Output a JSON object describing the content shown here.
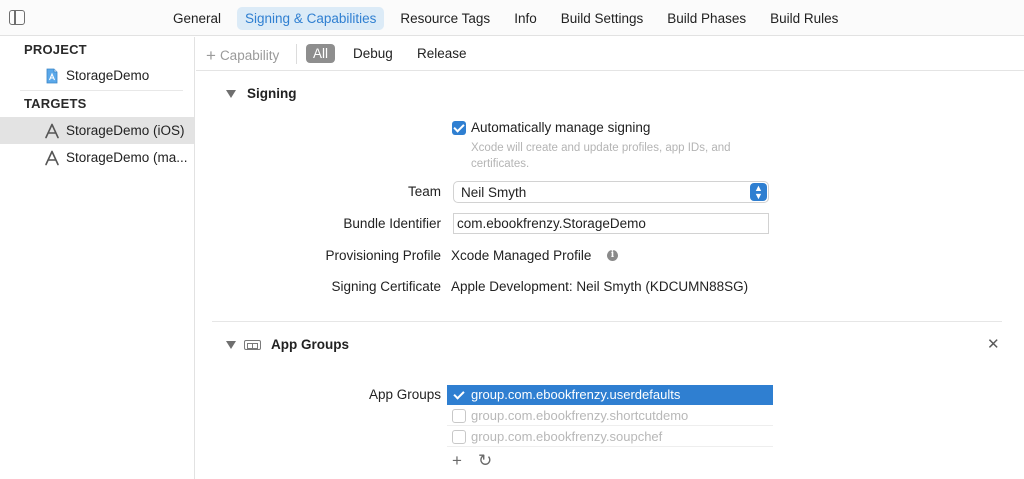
{
  "tabs": [
    {
      "label": "General"
    },
    {
      "label": "Signing & Capabilities",
      "active": true
    },
    {
      "label": "Resource Tags"
    },
    {
      "label": "Info"
    },
    {
      "label": "Build Settings"
    },
    {
      "label": "Build Phases"
    },
    {
      "label": "Build Rules"
    }
  ],
  "sidebar": {
    "project_header": "PROJECT",
    "project_item": "StorageDemo",
    "targets_header": "TARGETS",
    "targets": [
      {
        "label": "StorageDemo (iOS)",
        "selected": true
      },
      {
        "label": "StorageDemo (ma..."
      }
    ]
  },
  "toolbar": {
    "add_capability_label": "Capability",
    "filters": [
      {
        "label": "All",
        "active": true
      },
      {
        "label": "Debug"
      },
      {
        "label": "Release"
      }
    ]
  },
  "signing": {
    "title": "Signing",
    "auto_manage_label": "Automatically manage signing",
    "auto_manage_checked": true,
    "auto_manage_hint": "Xcode will create and update profiles, app IDs, and certificates.",
    "team_label": "Team",
    "team_value": "Neil Smyth",
    "bundle_label": "Bundle Identifier",
    "bundle_value": "com.ebookfrenzy.StorageDemo",
    "profile_label": "Provisioning Profile",
    "profile_value": "Xcode Managed Profile",
    "certificate_label": "Signing Certificate",
    "certificate_value": "Apple Development: Neil Smyth (KDCUMN88SG)"
  },
  "app_groups": {
    "title": "App Groups",
    "label": "App Groups",
    "groups": [
      {
        "id": "group.com.ebookfrenzy.userdefaults",
        "checked": true,
        "selected": true
      },
      {
        "id": "group.com.ebookfrenzy.shortcutdemo",
        "checked": false
      },
      {
        "id": "group.com.ebookfrenzy.soupchef",
        "checked": false
      }
    ]
  },
  "colors": {
    "accent": "#2f7fd1",
    "tab_active_bg": "#dcebf7",
    "sidebar_selected_bg": "#e3e3e3"
  }
}
